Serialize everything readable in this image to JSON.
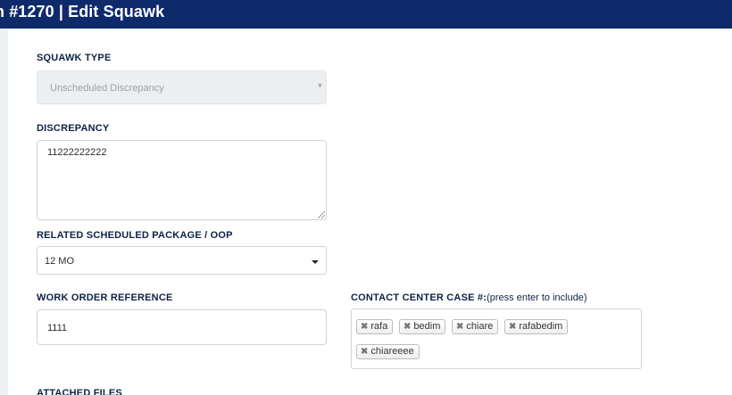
{
  "header": {
    "title": "n #1270 | Edit Squawk"
  },
  "form": {
    "squawk_type": {
      "label": "SQUAWK TYPE",
      "value": "Unscheduled Discrepancy"
    },
    "discrepancy": {
      "label": "DISCREPANCY",
      "value": "11222222222"
    },
    "related_package": {
      "label": "RELATED SCHEDULED PACKAGE / OOP",
      "value": "12 MO"
    },
    "work_order": {
      "label": "WORK ORDER REFERENCE",
      "value": "1111"
    },
    "contact_center": {
      "label": "CONTACT CENTER CASE #:",
      "hint": "(press enter to include)",
      "tags": [
        "rafa",
        "bedim",
        "chiare",
        "rafabedim",
        "chiareeee"
      ]
    },
    "attached_files": {
      "label": "ATTACHED FILES"
    }
  },
  "colors": {
    "header_bg": "#0f2a6b",
    "label": "#0d2346"
  },
  "icons": {
    "tag_remove": "close-icon",
    "select_caret": "chevron-down-icon"
  }
}
